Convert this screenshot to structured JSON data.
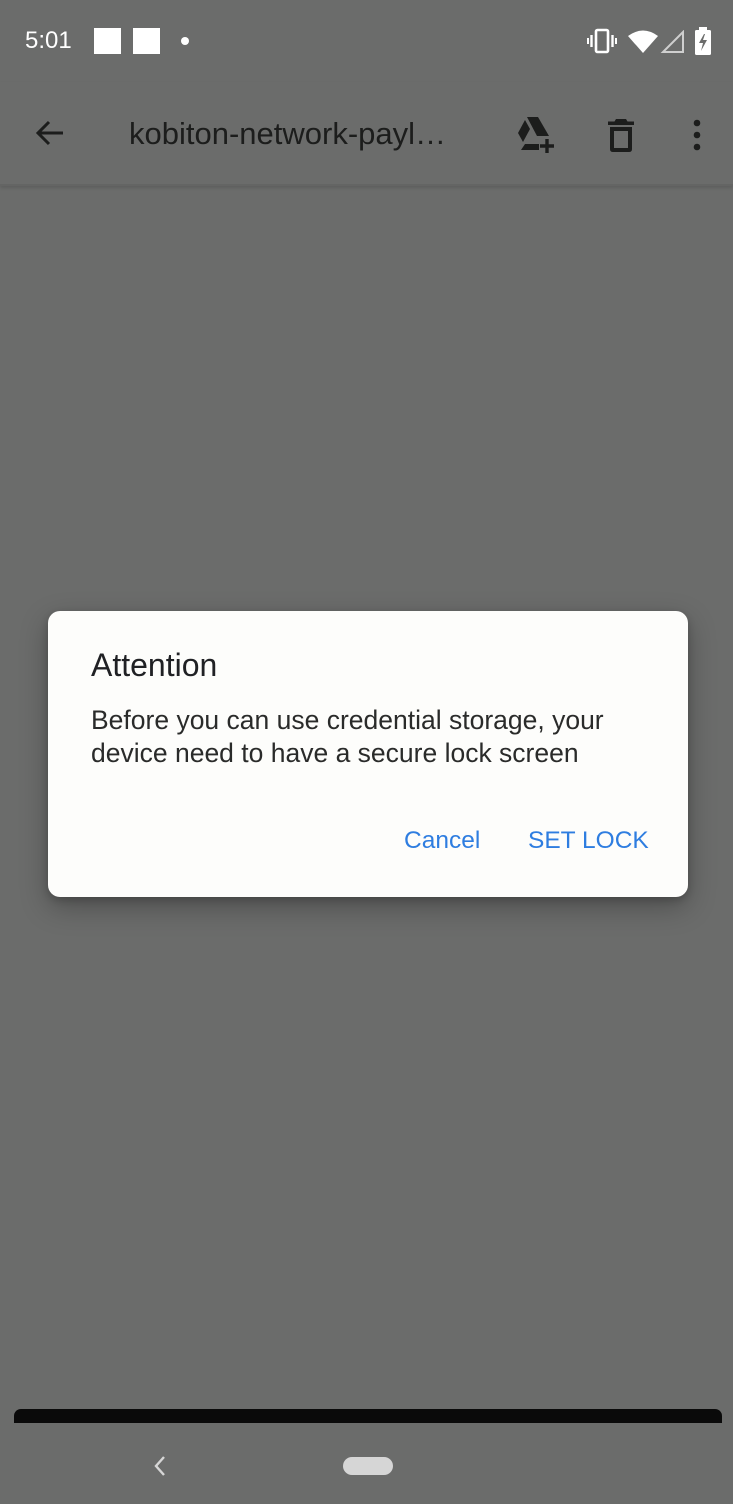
{
  "status_bar": {
    "time": "5:01"
  },
  "app_bar": {
    "title": "kobiton-network-payl…",
    "icons": [
      "arrow-back-icon",
      "drive-add-icon",
      "trash-icon",
      "more-vert-icon"
    ]
  },
  "dialog": {
    "title": "Attention",
    "body": "Before you can use credential storage, your device need to have a secure lock screen",
    "cancel_label": "Cancel",
    "confirm_label": "SET LOCK"
  },
  "colors": {
    "scrim_background": "#6b6c6b",
    "dialog_background": "#fdfdfb",
    "accent": "#2e7de0"
  }
}
